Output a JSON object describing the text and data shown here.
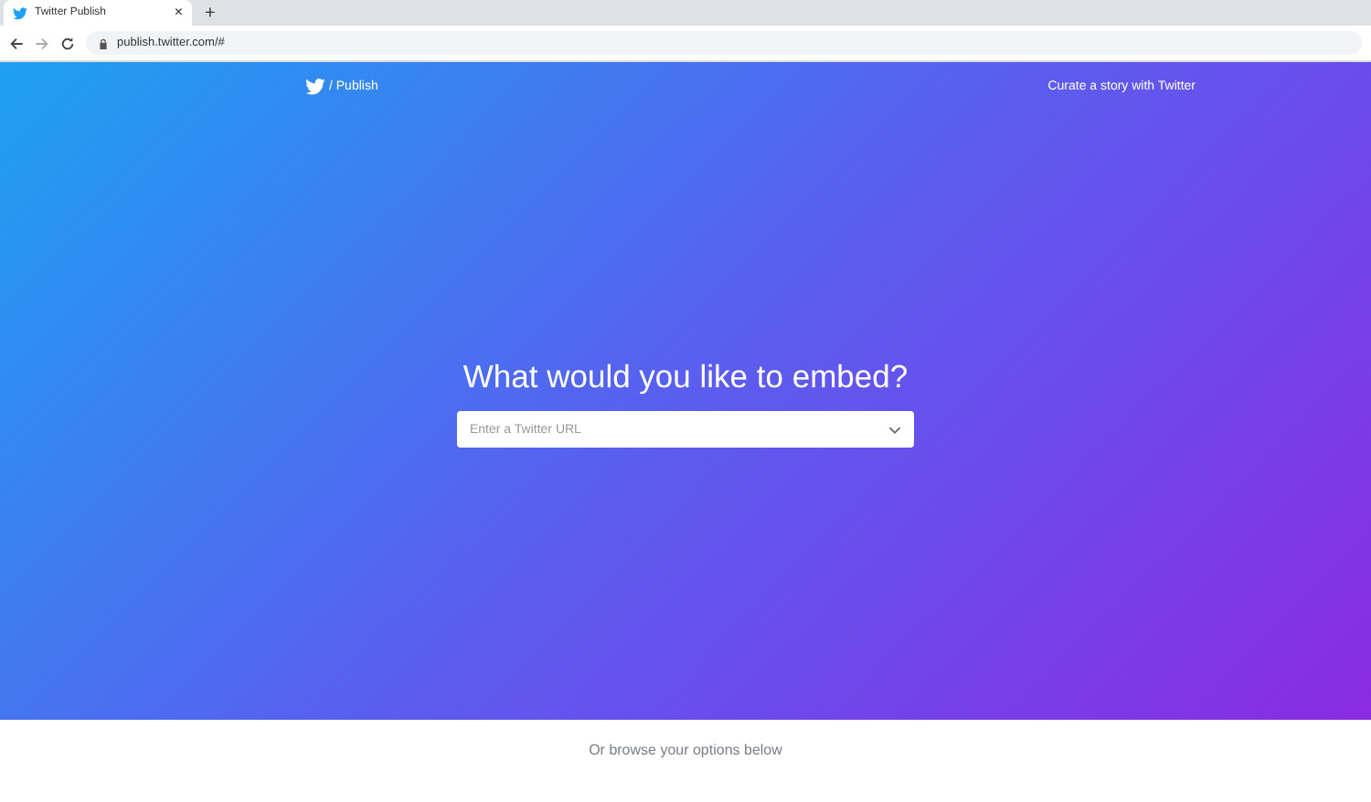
{
  "browser": {
    "tab": {
      "title": "Twitter Publish",
      "close": "×"
    },
    "new_tab": "+",
    "address": "publish.twitter.com/#"
  },
  "header": {
    "brand": "/ Publish",
    "link": "Curate a story with Twitter"
  },
  "hero": {
    "heading": "What would you like to embed?",
    "search": {
      "placeholder": "Enter a Twitter URL"
    }
  },
  "footer": {
    "text": "Or browse your options below"
  }
}
